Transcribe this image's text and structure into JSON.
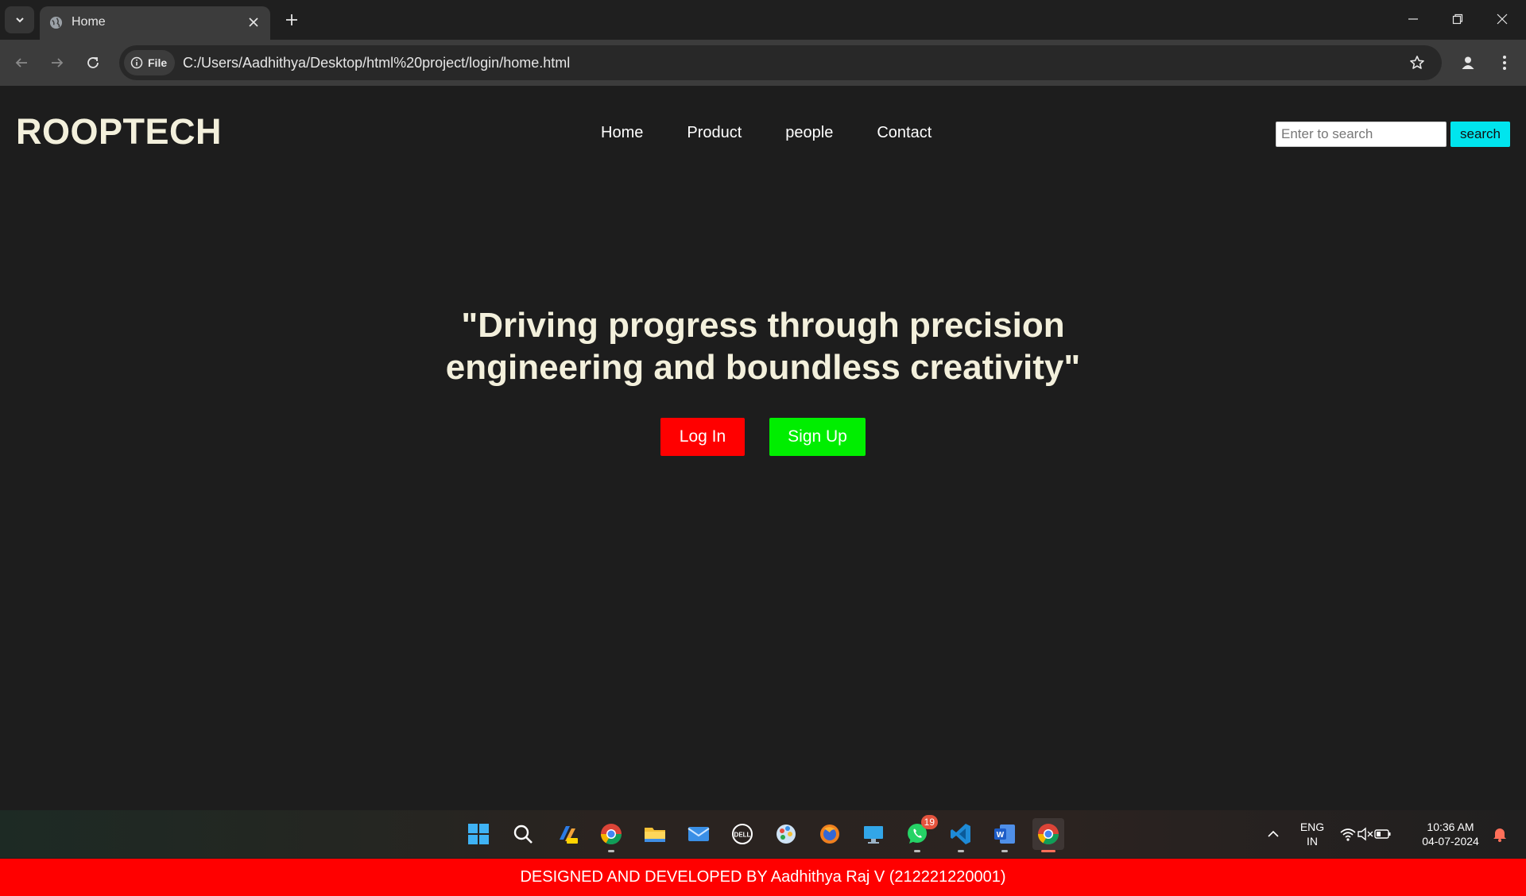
{
  "browser": {
    "tab_title": "Home",
    "file_chip_label": "File",
    "url": "C:/Users/Aadhithya/Desktop/html%20project/login/home.html"
  },
  "page": {
    "logo": "ROOPTECH",
    "nav": [
      "Home",
      "Product",
      "people",
      "Contact"
    ],
    "search": {
      "placeholder": "Enter to search",
      "button_label": "search"
    },
    "hero_lines": [
      "\"Driving progress through precision",
      "engineering and boundless creativity\""
    ],
    "login_label": "Log In",
    "signup_label": "Sign Up",
    "footer": "DESIGNED AND DEVELOPED BY Aadhithya Raj V (212221220001)",
    "colors": {
      "background": "#1d1d1d",
      "accent_red": "#ff0000",
      "accent_green": "#00ee00",
      "search_button": "#00e5ee",
      "title_text": "#f3f0dc"
    }
  },
  "taskbar": {
    "whatsapp_badge": "19",
    "language": {
      "line1": "ENG",
      "line2": "IN"
    },
    "clock": {
      "time": "10:36 AM",
      "date": "04-07-2024"
    },
    "pinned_icons": [
      "windows-start-icon",
      "search-icon",
      "copilot-icon",
      "chrome-canary-icon",
      "file-explorer-icon",
      "mail-icon",
      "dell-icon",
      "paint-icon",
      "firefox-icon",
      "desktop-icon",
      "whatsapp-icon",
      "vscode-icon",
      "word-icon",
      "chrome-icon"
    ]
  }
}
